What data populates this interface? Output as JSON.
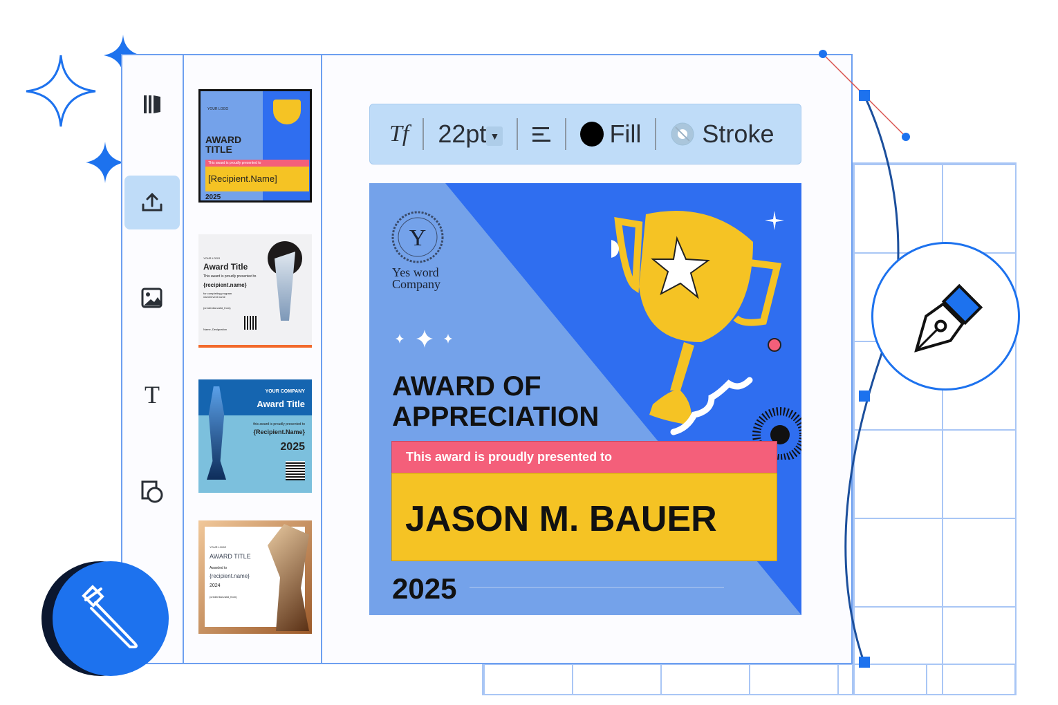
{
  "sidebar": {
    "items": [
      {
        "name": "templates",
        "icon": "book-panel-icon"
      },
      {
        "name": "upload",
        "icon": "upload-icon",
        "active": true
      },
      {
        "name": "images",
        "icon": "image-icon"
      },
      {
        "name": "text",
        "icon": "text-icon",
        "label": "T"
      },
      {
        "name": "shapes",
        "icon": "shapes-icon"
      }
    ]
  },
  "thumbnails": [
    {
      "title": "AWARD TITLE",
      "subtitle": "This award is proudly presented to",
      "recipient": "[Recipient.Name]",
      "year": "2025",
      "logo": "YOUR LOGO",
      "selected": true
    },
    {
      "title": "Award Title",
      "subtitle": "This award is proudly presented to",
      "recipient": "{recipient.name}",
      "detail": "for completing program name/event name",
      "credential": "{credential.valid_from}",
      "signature": "Name, Designation",
      "logo": "YOUR LOGO"
    },
    {
      "company": "YOUR COMPANY",
      "title": "Award Title",
      "subtitle": "this award is proudly presented to",
      "recipient": "{Recipient.Name}",
      "year": "2025"
    },
    {
      "title": "AWARD TITLE",
      "subtitle": "Awarded to",
      "recipient": "{recipient.name}",
      "year": "2024",
      "credential": "{credential.valid_from}",
      "logo": "YOUR LOGO"
    }
  ],
  "toolbar": {
    "font_icon": "Tf",
    "font_size": "22pt",
    "align_icon": "align-left-icon",
    "fill_label": "Fill",
    "fill_color": "#000000",
    "stroke_label": "Stroke"
  },
  "certificate": {
    "logo_letter": "Y",
    "company_line1": "Yes word",
    "company_line2": "Company",
    "title_line1": "AWARD OF",
    "title_line2": "APPRECIATION",
    "presented": "This award is proudly presented to",
    "recipient": "JASON M. BAUER",
    "year": "2025",
    "colors": {
      "blue": "#2f6ef0",
      "light_blue": "#74a2ea",
      "pink": "#f45f7a",
      "yellow": "#f5c324"
    }
  },
  "tools": {
    "pen": "pen-tool-icon",
    "eyedropper": "eyedropper-icon"
  }
}
